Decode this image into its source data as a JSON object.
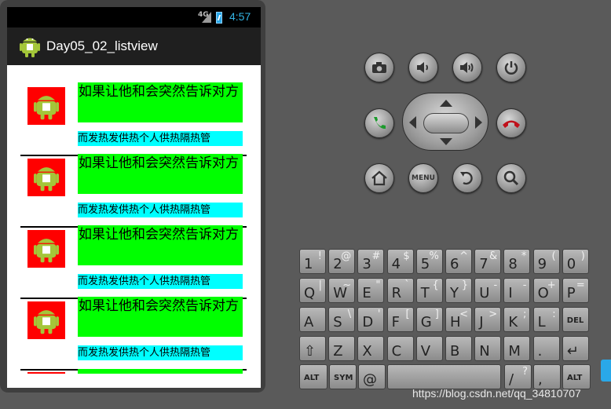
{
  "status_bar": {
    "network": "4G",
    "time": "4:57"
  },
  "app": {
    "title": "Day05_02_listview"
  },
  "list": {
    "items": [
      {
        "title": "如果让他和会突然告诉对方",
        "desc": "而发热发供热个人供热隔热管"
      },
      {
        "title": "如果让他和会突然告诉对方",
        "desc": "而发热发供热个人供热隔热管"
      },
      {
        "title": "如果让他和会突然告诉对方",
        "desc": "而发热发供热个人供热隔热管"
      },
      {
        "title": "如果让他和会突然告诉对方",
        "desc": "而发热发供热个人供热隔热管"
      }
    ]
  },
  "hardware_buttons": {
    "camera": "camera-icon",
    "volume_down": "volume-down-icon",
    "volume_up": "volume-up-icon",
    "power": "power-icon",
    "call": "call-icon",
    "end_call": "end-call-icon",
    "home": "home-icon",
    "menu": "MENU",
    "back": "back-icon",
    "search": "search-icon"
  },
  "keyboard": {
    "row1": [
      [
        "1",
        "!"
      ],
      [
        "2",
        "@"
      ],
      [
        "3",
        "#"
      ],
      [
        "4",
        "$"
      ],
      [
        "5",
        "%"
      ],
      [
        "6",
        "^"
      ],
      [
        "7",
        "&"
      ],
      [
        "8",
        "*"
      ],
      [
        "9",
        "("
      ],
      [
        "0",
        ")"
      ]
    ],
    "row2": [
      [
        "Q",
        "|"
      ],
      [
        "W",
        "~"
      ],
      [
        "E",
        "\""
      ],
      [
        "R",
        "`"
      ],
      [
        "T",
        "{"
      ],
      [
        "Y",
        "}"
      ],
      [
        "U",
        "-"
      ],
      [
        "I",
        "-"
      ],
      [
        "O",
        "+"
      ],
      [
        "P",
        "="
      ]
    ],
    "row3": [
      [
        "A",
        ""
      ],
      [
        "S",
        "\\"
      ],
      [
        "D",
        "'"
      ],
      [
        "F",
        "["
      ],
      [
        "G",
        "]"
      ],
      [
        "H",
        "<"
      ],
      [
        "J",
        ">"
      ],
      [
        "K",
        ";"
      ],
      [
        "L",
        ":"
      ],
      [
        "DEL",
        ""
      ]
    ],
    "row4": [
      [
        "⇧",
        ""
      ],
      [
        "Z",
        ""
      ],
      [
        "X",
        ""
      ],
      [
        "C",
        ""
      ],
      [
        "V",
        ""
      ],
      [
        "B",
        ""
      ],
      [
        "N",
        ""
      ],
      [
        "M",
        ""
      ],
      [
        ".",
        ""
      ],
      [
        "↵",
        ""
      ]
    ],
    "row5": [
      [
        "ALT",
        ""
      ],
      [
        "SYM",
        ""
      ],
      [
        "@",
        ""
      ],
      [
        "",
        ""
      ],
      [
        "/",
        "?"
      ],
      [
        ",",
        ""
      ],
      [
        "ALT",
        ""
      ]
    ]
  },
  "watermark": "https://blog.csdn.net/qq_34810707",
  "colors": {
    "title_bg": "#00ff00",
    "desc_bg": "#00ffff",
    "thumb_bg": "#ff0000",
    "clock": "#33b5e5"
  }
}
